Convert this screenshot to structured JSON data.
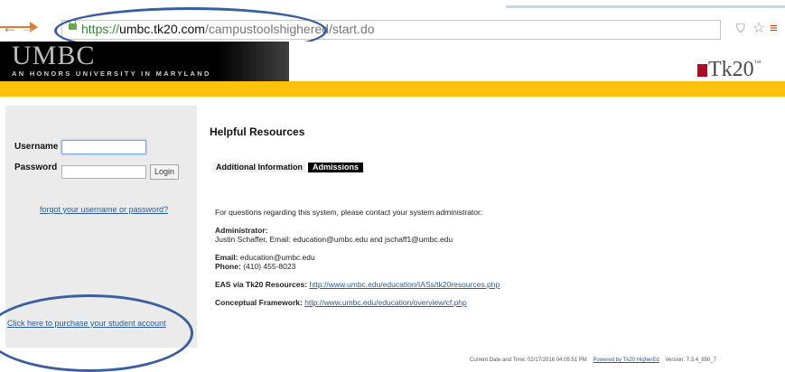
{
  "browser": {
    "url_protocol": "https://",
    "url_host": "umbc.tk20.com",
    "url_path": "/campustoolshighered/start.do",
    "nav_back": "←",
    "nav_forward": "→",
    "star_icon": "☆",
    "menu_icon": "≡",
    "shield_icon": "⛉"
  },
  "banner": {
    "university_logo": "UMBC",
    "university_tagline": "AN HONORS UNIVERSITY IN MARYLAND",
    "vendor_logo": "Tk20",
    "vendor_tm": "™"
  },
  "login": {
    "username_label": "Username",
    "password_label": "Password",
    "login_button": "Login",
    "forgot_link": "forgot your username or password?",
    "purchase_link": "Click here to purchase your student account"
  },
  "main": {
    "title": "Helpful Resources",
    "tabs": [
      {
        "label": "Additional Information"
      },
      {
        "label": "Admissions"
      }
    ],
    "intro": "For questions regarding this system, please contact your system administrator:",
    "admin_heading": "Administrator:",
    "admin_text": "Justin Schaffer, Email: education@umbc.edu and jschaff1@umbc.edu",
    "email_label": "Email:",
    "email_value": "education@umbc.edu",
    "phone_label": "Phone:",
    "phone_value": "(410) 455-8023",
    "eas_label": "EAS via Tk20 Resources:",
    "eas_link": "http://www.umbc.edu/education/IASs/tk20resources.php",
    "cf_label": "Conceptual Framework:",
    "cf_link": "http://www.umbc.edu/education/overview/cf.php"
  },
  "footer": {
    "datetime": "Current Date and Time: 02/17/2016 04:05:51 PM",
    "powered": "Powered by Tk20 HigherEd",
    "version": "Version: 7.3.4_850_7"
  },
  "colors": {
    "gold_bar": "#fcc30b",
    "annotation_ring": "#3a5ea0",
    "annotation_arrow": "#e57a2c",
    "link": "#2a5d8f"
  }
}
